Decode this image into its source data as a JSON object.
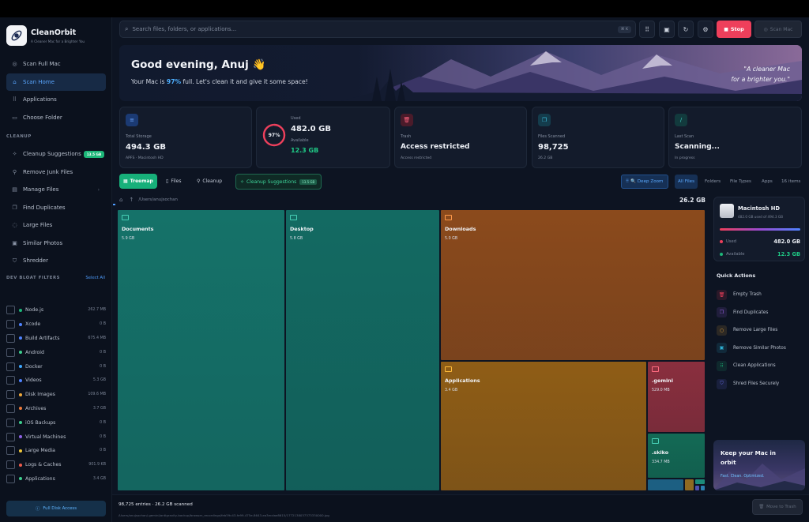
{
  "brand": {
    "name": "CleanOrbit",
    "tagline": "A Cleaner Mac for a Brighter You"
  },
  "nav": [
    {
      "label": "Scan Full Mac",
      "icon": "radar-icon"
    },
    {
      "label": "Scan Home",
      "icon": "home-icon",
      "active": true
    },
    {
      "label": "Applications",
      "icon": "grid-icon"
    },
    {
      "label": "Choose Folder",
      "icon": "folder-icon"
    }
  ],
  "cleanup_section": "CLEANUP",
  "cleanup_items": [
    {
      "label": "Cleanup Suggestions",
      "icon": "sparkle-icon",
      "badge": "13.5 GB"
    },
    {
      "label": "Remove Junk Files",
      "icon": "broom-icon"
    },
    {
      "label": "Manage Files",
      "icon": "files-icon",
      "chevron": "›"
    },
    {
      "label": "Find Duplicates",
      "icon": "duplicate-icon"
    },
    {
      "label": "Large Files",
      "icon": "large-file-icon"
    },
    {
      "label": "Similar Photos",
      "icon": "photo-icon"
    },
    {
      "label": "Shredder",
      "icon": "shield-icon"
    }
  ],
  "dev_section": "DEV BLOAT FILTERS",
  "select_all": "Select All",
  "dev_filters": [
    {
      "label": "Node.js",
      "size": "262.7 MB",
      "color": "#1db779"
    },
    {
      "label": "Xcode",
      "size": "0 B",
      "color": "#4f83ff"
    },
    {
      "label": "Build Artifacts",
      "size": "675.4 MB",
      "color": "#4f83ff"
    },
    {
      "label": "Android",
      "size": "0 B",
      "color": "#3ecf8e"
    },
    {
      "label": "Docker",
      "size": "0 B",
      "color": "#3ea8ff"
    },
    {
      "label": "Videos",
      "size": "5.3 GB",
      "color": "#4f83ff"
    },
    {
      "label": "Disk Images",
      "size": "109.6 MB",
      "color": "#f0a93b"
    },
    {
      "label": "Archives",
      "size": "3.7 GB",
      "color": "#ee7b3b"
    },
    {
      "label": "iOS Backups",
      "size": "0 B",
      "color": "#3ecf8e"
    },
    {
      "label": "Virtual Machines",
      "size": "0 B",
      "color": "#8f62e6"
    },
    {
      "label": "Large Media",
      "size": "0 B",
      "color": "#f0c83b"
    },
    {
      "label": "Logs & Caches",
      "size": "901.9 KB",
      "color": "#ee5b4b"
    },
    {
      "label": "Applications",
      "size": "3.4 GB",
      "color": "#3ecf8e"
    }
  ],
  "full_disk": "Full Disk Access",
  "search": {
    "placeholder": "Search files, folders, or applications...",
    "shortcut": "⌘ K"
  },
  "toolbar": {
    "stop": "Stop",
    "scan_mac": "Scan Mac"
  },
  "hero": {
    "greeting": "Good evening, Anuj 👋",
    "sub_prefix": "Your Mac is ",
    "sub_percent": "97%",
    "sub_suffix": " full. Let's clean it and give it some space!",
    "quote_line1": "\"A cleaner Mac",
    "quote_line2": "for a brighter you.\""
  },
  "stats": {
    "total": {
      "label": "Total Storage",
      "value": "494.3 GB",
      "sub": "APFS · Macintosh HD"
    },
    "used": {
      "label": "Used",
      "value": "482.0 GB",
      "avail_label": "Available",
      "avail_value": "12.3 GB",
      "percent": "97%",
      "fraction": 0.97
    },
    "trash": {
      "label": "Trash",
      "value": "Access restricted",
      "sub": "Access restricted"
    },
    "scanned": {
      "label": "Files Scanned",
      "value": "98,725",
      "sub": "26.2 GB"
    },
    "last": {
      "label": "Last Scan",
      "value": "Scanning...",
      "sub": "In progress"
    }
  },
  "tabs": {
    "treemap": "Treemap",
    "files": "Files",
    "cleanup": "Cleanup",
    "suggestions": "Cleanup Suggestions",
    "suggestions_badge": "13.5 GB"
  },
  "view_filters": {
    "deep_zoom": "🔍 Deep Zoom",
    "all_files": "All Files",
    "folders": "Folders",
    "file_types": "File Types",
    "apps": "Apps",
    "count": "16 items"
  },
  "path": {
    "current": "/Users/anujsochan",
    "total": "26.2 GB"
  },
  "treemap": [
    {
      "name": "Documents",
      "size": "5.9 GB",
      "color": "#157269"
    },
    {
      "name": "Desktop",
      "size": "5.8 GB",
      "color": "#136a62"
    },
    {
      "name": "Downloads",
      "size": "5.0 GB",
      "color": "#8b4a1c"
    },
    {
      "name": "Applications",
      "size": "3.4 GB",
      "color": "#8f5d16"
    },
    {
      "name": ".gemini",
      "size": "529.0 MB",
      "color": "#8a2f3e"
    },
    {
      "name": ".skiko",
      "size": "334.7 MB",
      "color": "#136a55"
    }
  ],
  "disk": {
    "name": "Macintosh HD",
    "sub": "482.0 GB used of 494.3 GB",
    "used_label": "Used",
    "used_value": "482.0 GB",
    "avail_label": "Available",
    "avail_value": "12.3 GB"
  },
  "quick_actions": {
    "title": "Quick Actions",
    "items": [
      {
        "label": "Empty Trash",
        "icon": "trash-icon",
        "color": "#ee3f5b"
      },
      {
        "label": "Find Duplicates",
        "icon": "duplicate-icon",
        "color": "#9a62e6"
      },
      {
        "label": "Remove Large Files",
        "icon": "large-file-icon",
        "color": "#f0a93b"
      },
      {
        "label": "Remove Similar Photos",
        "icon": "photo-icon",
        "color": "#2eb2d6"
      },
      {
        "label": "Clean Applications",
        "icon": "grid-icon",
        "color": "#1db779"
      },
      {
        "label": "Shred Files Securely",
        "icon": "shield-icon",
        "color": "#6b6ef0"
      }
    ]
  },
  "promo": {
    "title": "Keep your Mac in orbit",
    "sub": "Fast. Clean. Optimized."
  },
  "footer": {
    "summary": "98,725 entries · 26.2 GB scanned",
    "path": "/Users/anujsochan/.gemini/antigravity-backup/browser_recordings/feb59c43-fe99-475e-8643-ea3ecdae8615/1772138037373330000.jpg",
    "move_trash": "Move to Trash"
  }
}
